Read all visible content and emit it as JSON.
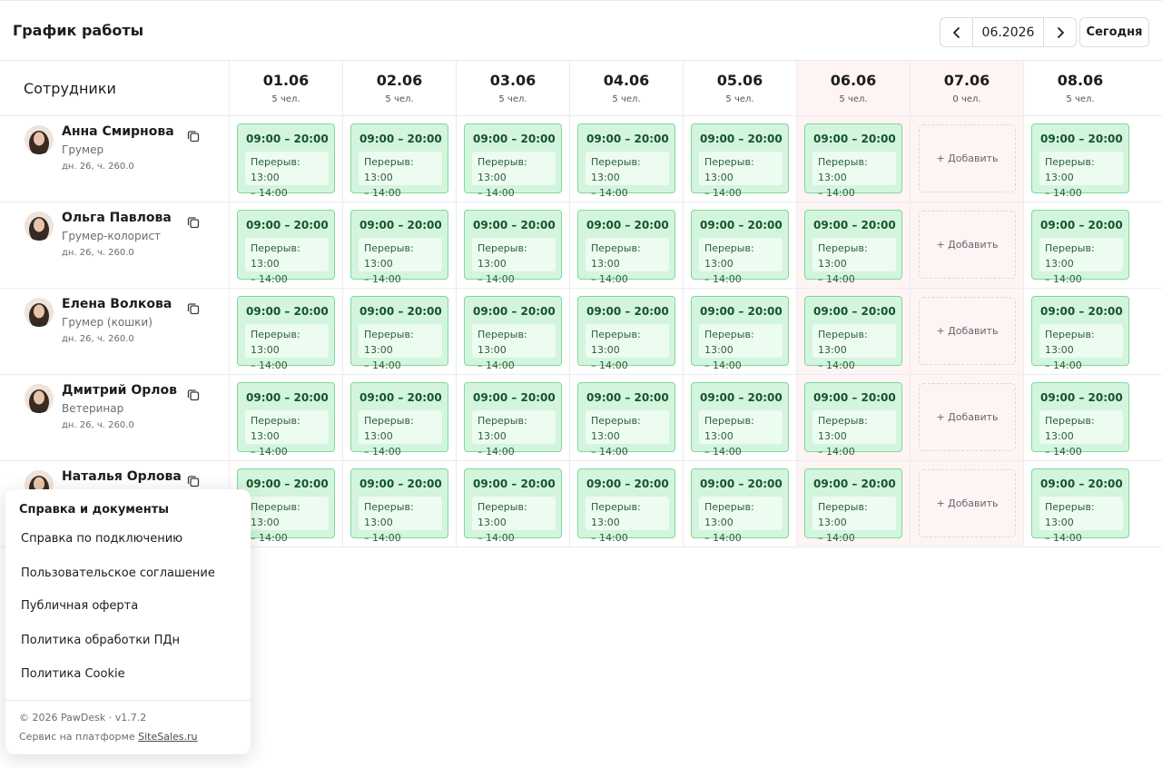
{
  "header": {
    "title": "График работы",
    "month": "06.2026",
    "today_label": "Сегодня"
  },
  "grid": {
    "employees_header": "Сотрудники",
    "days": [
      {
        "date": "01.06",
        "count": "5 чел.",
        "weekend": false
      },
      {
        "date": "02.06",
        "count": "5 чел.",
        "weekend": false
      },
      {
        "date": "03.06",
        "count": "5 чел.",
        "weekend": false
      },
      {
        "date": "04.06",
        "count": "5 чел.",
        "weekend": false
      },
      {
        "date": "05.06",
        "count": "5 чел.",
        "weekend": false
      },
      {
        "date": "06.06",
        "count": "5 чел.",
        "weekend": true
      },
      {
        "date": "07.06",
        "count": "0 чел.",
        "weekend": true
      },
      {
        "date": "08.06",
        "count": "5 чел.",
        "weekend": false
      }
    ],
    "employees": [
      {
        "name": "Анна Смирнова",
        "role": "Грумер",
        "meta": "дн. 26, ч. 260.0"
      },
      {
        "name": "Ольга Павлова",
        "role": "Грумер-колорист",
        "meta": "дн. 26, ч. 260.0"
      },
      {
        "name": "Елена Волкова",
        "role": "Грумер (кошки)",
        "meta": "дн. 26, ч. 260.0"
      },
      {
        "name": "Дмитрий Орлов",
        "role": "Ветеринар",
        "meta": "дн. 26, ч. 260.0"
      },
      {
        "name": "Наталья Орлова",
        "role": "",
        "meta": ""
      }
    ],
    "shift": {
      "time": "09:00 – 20:00",
      "break_line1": "Перерыв: 13:00",
      "break_line2": "– 14:00"
    },
    "add_label": "+ Добавить"
  },
  "popup": {
    "title": "Справка и документы",
    "links": [
      "Справка по подключению",
      "Пользовательское соглашение",
      "Публичная оферта",
      "Политика обработки ПДн",
      "Политика Cookie"
    ],
    "copyright": "© 2026 PawDesk · v1.7.2",
    "platform_prefix": "Сервис на платформе",
    "platform_link": "SiteSales.ru"
  },
  "icons": {
    "prev": "chevron-left-icon",
    "next": "chevron-right-icon",
    "copy": "copy-icon",
    "avatar": "avatar-photo"
  },
  "colors": {
    "shift_bg": "#d3f5dd",
    "shift_border": "#7fd99a",
    "weekend_bg": "#fff4f4"
  }
}
